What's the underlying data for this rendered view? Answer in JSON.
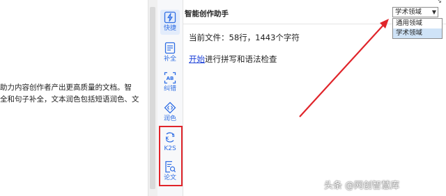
{
  "document": {
    "lines": [
      "助力内容创作者产出更高质量的文档。智",
      "全和句子补全，文本润色包括短语润色、文"
    ]
  },
  "toolbar": {
    "items": [
      {
        "label": "快捷",
        "icon": "lightning-icon"
      },
      {
        "label": "补全",
        "icon": "completion-icon"
      },
      {
        "label": "纠错",
        "icon": "spellcheck-icon"
      },
      {
        "label": "润色",
        "icon": "polish-icon"
      },
      {
        "label": "K2S",
        "icon": "k2s-icon"
      },
      {
        "label": "论文",
        "icon": "paper-search-icon"
      }
    ]
  },
  "panel": {
    "title": "智能创作助手",
    "domain_select": {
      "value": "学术领域",
      "options": [
        "通用领域",
        "学术领域"
      ]
    },
    "file_info": "当前文件：58行，1443个字符",
    "check": {
      "link": "开始",
      "text": "进行拼写和语法检查"
    }
  },
  "watermark": "头条 @网创智慧库",
  "colors": {
    "accent": "#2f6ee4",
    "highlight": "#e0242a",
    "link": "#1a3fd8"
  }
}
